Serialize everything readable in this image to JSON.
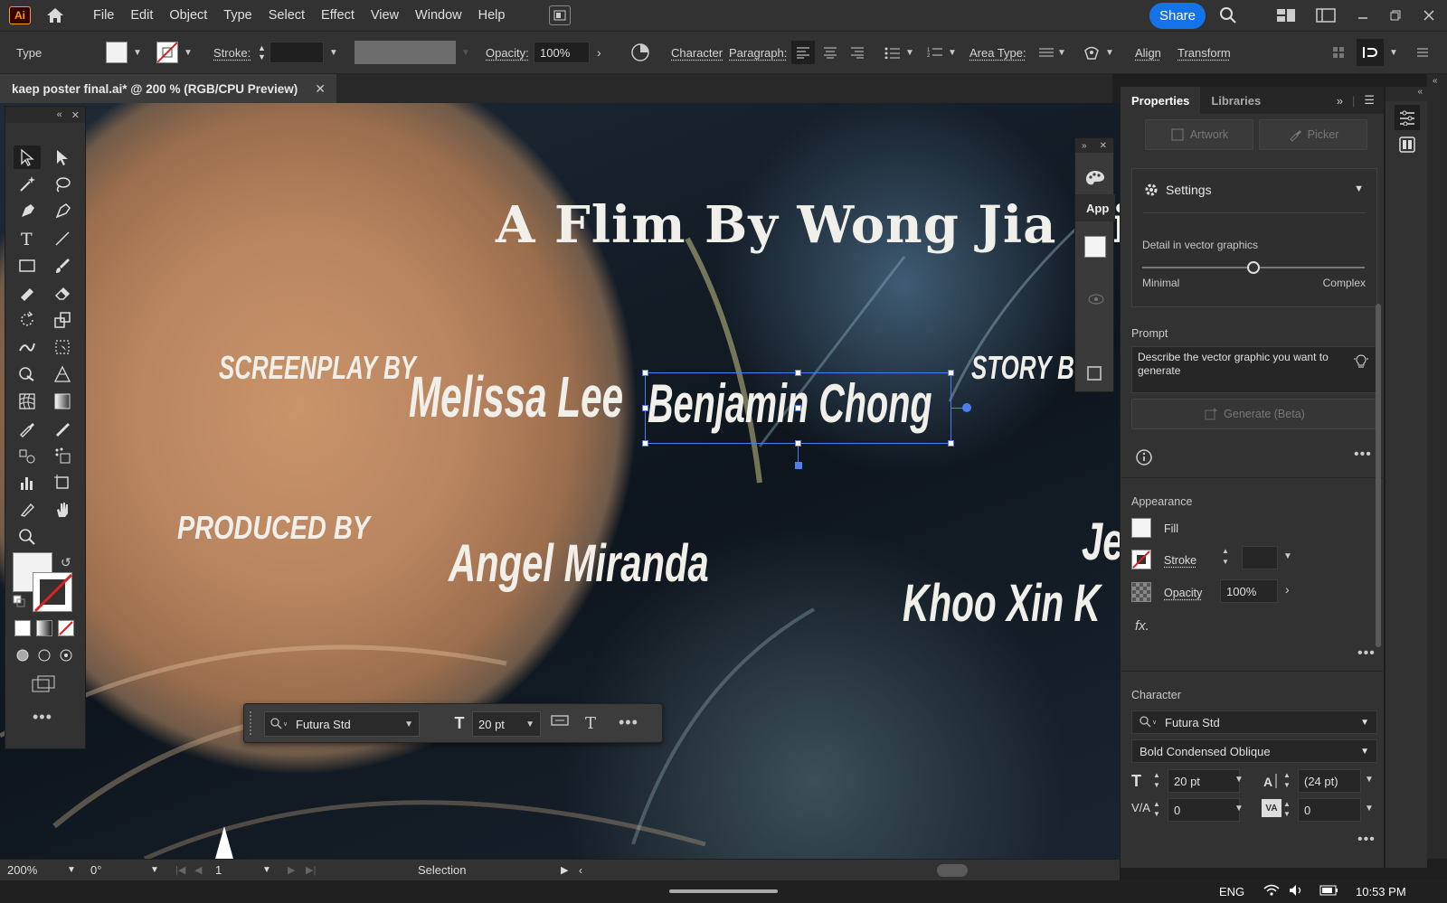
{
  "app": {
    "logo_text": "Ai"
  },
  "menu": [
    "File",
    "Edit",
    "Object",
    "Type",
    "Select",
    "Effect",
    "View",
    "Window",
    "Help"
  ],
  "share_label": "Share",
  "control_bar": {
    "tool_name": "Type",
    "stroke_label": "Stroke:",
    "opacity_label": "Opacity:",
    "opacity_value": "100%",
    "character_label": "Character",
    "paragraph_label": "Paragraph:",
    "area_type_label": "Area Type:",
    "align_label": "Align",
    "transform_label": "Transform"
  },
  "document_tab": {
    "title": "kaep poster final.ai* @ 200 % (RGB/CPU Preview)"
  },
  "poster": {
    "title": "A Flim By Wong Jia Yi",
    "screenplay_label": "SCREENPLAY BY",
    "screenplay_name1": "Melissa Lee",
    "screenplay_name2": "Benjamin  Chong",
    "story_label": "STORY BY",
    "produced_label": "PRODUCED BY",
    "produced_name": "Angel Miranda",
    "right_name_partial": "Je",
    "right_name2": "Khoo Xin K"
  },
  "mini_panel": {
    "label": "App"
  },
  "context_bar": {
    "font": "Futura Std",
    "size": "20 pt"
  },
  "properties": {
    "tabs": [
      "Properties",
      "Libraries"
    ],
    "artwork_label": "Artwork",
    "picker_label": "Picker",
    "settings_title": "Settings",
    "detail_label": "Detail in vector graphics",
    "detail_min": "Minimal",
    "detail_max": "Complex",
    "detail_level": 0.5,
    "prompt_title": "Prompt",
    "prompt_placeholder": "Describe the vector graphic you want to generate",
    "generate_label": "Generate (Beta)",
    "appearance_title": "Appearance",
    "fill_label": "Fill",
    "stroke_label": "Stroke",
    "opacity_label": "Opacity",
    "opacity_value": "100%",
    "fx_label": "fx.",
    "character_title": "Character",
    "font_family": "Futura Std",
    "font_style": "Bold Condensed Oblique",
    "font_size": "20 pt",
    "leading": "(24 pt)",
    "kerning": "0",
    "tracking": "0"
  },
  "status_bar": {
    "zoom": "200%",
    "rotation": "0°",
    "artboard": "1",
    "tool": "Selection"
  },
  "taskbar": {
    "language": "ENG",
    "time": "10:53 PM"
  },
  "colors": {
    "accent": "#1473e6",
    "selection": "#4d7df0",
    "logo": "#ff9a00"
  }
}
